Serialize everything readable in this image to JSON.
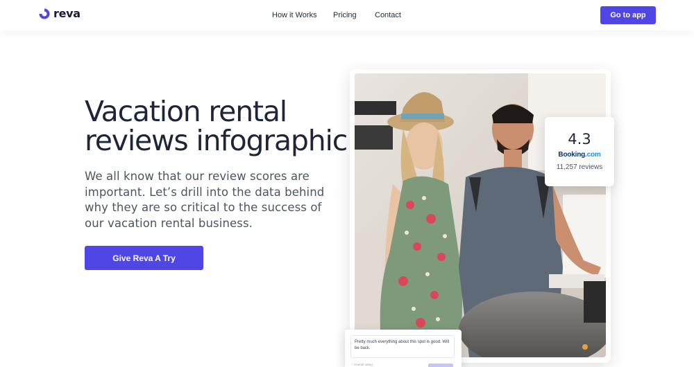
{
  "brand": {
    "name": "reva",
    "accent": "#4f46e5"
  },
  "nav": {
    "items": [
      {
        "label": "How it Works"
      },
      {
        "label": "Pricing"
      },
      {
        "label": "Contact"
      }
    ],
    "cta_label": "Go to app"
  },
  "hero": {
    "title_line1": "Vacation rental",
    "title_line2": "reviews infographic",
    "subtitle": "We all know that our review scores are important. Let’s drill into the data behind why they are so critical to the success of our vacation rental business.",
    "button_label": "Give Reva A Try"
  },
  "rating_card": {
    "score": "4.3",
    "brand_main": "Booking",
    "brand_suffix": ".com",
    "reviews": "11,257 reviews"
  },
  "review_widget": {
    "text": "Pretty much everything about this spot is good. Will be back.",
    "label": "* Overall rating"
  }
}
